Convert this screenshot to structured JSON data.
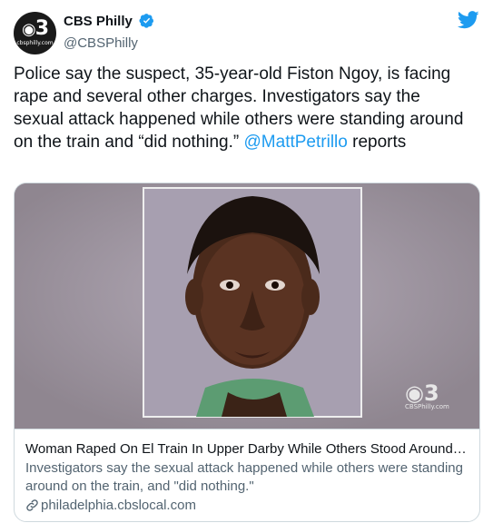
{
  "account": {
    "display_name": "CBS Philly",
    "handle": "@CBSPhilly",
    "avatar_text": "3",
    "avatar_domain": "cbsphilly.com"
  },
  "tweet": {
    "text_before_mention": "Police say the suspect, 35-year-old Fiston Ngoy, is facing rape and several other charges. Investigators say the sexual attack happened while others were standing around on the train and “did nothing.” ",
    "mention": "@MattPetrillo",
    "text_after_mention": " reports"
  },
  "card": {
    "watermark": "CBSPhilly.com",
    "title": "Woman Raped On El Train In Upper Darby While Others Stood Around A...",
    "description": "Investigators say the sexual attack happened while others were standing around on the train, and \"did nothing.\"",
    "link": "philadelphia.cbslocal.com"
  },
  "colors": {
    "twitter_blue": "#1d9bf0",
    "text": "#0f1419",
    "secondary_text": "#536471",
    "border": "#cfd9de"
  },
  "icons": [
    "verified-badge-icon",
    "twitter-bird-icon",
    "link-icon"
  ]
}
